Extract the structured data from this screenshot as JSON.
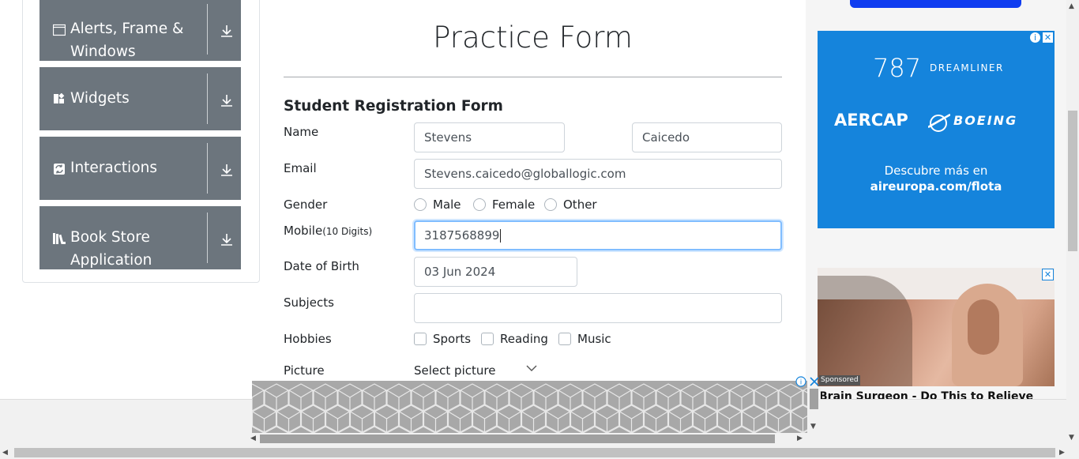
{
  "sidebar": {
    "groups": [
      {
        "label_line1": "Alerts, Frame &",
        "label_line2": "Windows",
        "icon": "window-icon"
      },
      {
        "label": "Widgets",
        "icon": "widgets-icon"
      },
      {
        "label": "Interactions",
        "icon": "interactions-icon"
      },
      {
        "label_line1": "Book Store",
        "label_line2": "Application",
        "icon": "books-icon"
      }
    ]
  },
  "form": {
    "title": "Practice Form",
    "subtitle": "Student Registration Form",
    "name_label": "Name",
    "first_name": "Stevens",
    "last_name": "Caicedo",
    "email_label": "Email",
    "email": "Stevens.caicedo@globallogic.com",
    "gender_label": "Gender",
    "gender_options": [
      "Male",
      "Female",
      "Other"
    ],
    "mobile_label": "Mobile",
    "mobile_hint": "(10 Digits)",
    "mobile": "3187568899",
    "dob_label": "Date of Birth",
    "dob": "03 Jun 2024",
    "subjects_label": "Subjects",
    "subjects": "",
    "hobbies_label": "Hobbies",
    "hobby_options": [
      "Sports",
      "Reading",
      "Music"
    ],
    "picture_label": "Picture",
    "picture_button": "Select picture"
  },
  "ads": {
    "blue_ad": {
      "brand_787": "787",
      "brand_dreamliner": "DREAMLINER",
      "brand_aercap": "AERCAP",
      "brand_boeing": "BOEING",
      "tagline": "Descubre más en",
      "url": "aireuropa.com/flota"
    },
    "sponsored_label": "Sponsored",
    "headline": "Brain Surgeon - Do This to Relieve"
  },
  "colors": {
    "nav_group_bg": "#6c757d",
    "ad_blue": "#1584dc",
    "focus_border": "#80bdff"
  }
}
